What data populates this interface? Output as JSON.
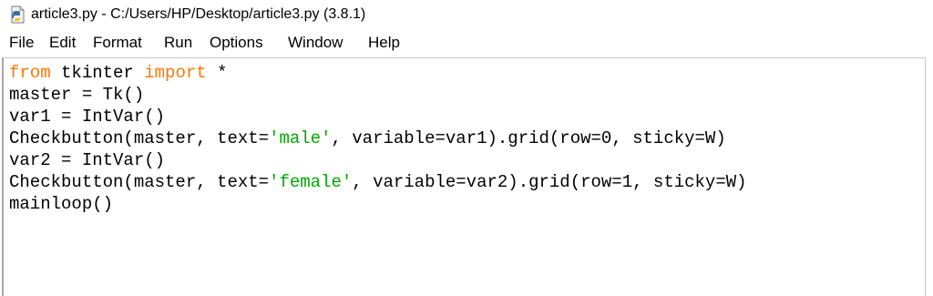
{
  "window": {
    "title": "article3.py - C:/Users/HP/Desktop/article3.py (3.8.1)",
    "icon": "python-file-icon"
  },
  "menu": [
    "File",
    "Edit",
    "Format",
    "Run",
    "Options",
    "Window",
    "Help"
  ],
  "code": [
    [
      {
        "t": "from",
        "c": "kw"
      },
      {
        "t": " tkinter "
      },
      {
        "t": "import",
        "c": "kw"
      },
      {
        "t": " *"
      }
    ],
    [
      {
        "t": "master = Tk()"
      }
    ],
    [
      {
        "t": "var1 = IntVar()"
      }
    ],
    [
      {
        "t": "Checkbutton(master, text="
      },
      {
        "t": "'male'",
        "c": "str"
      },
      {
        "t": ", variable=var1).grid(row=0, sticky=W)"
      }
    ],
    [
      {
        "t": "var2 = IntVar()"
      }
    ],
    [
      {
        "t": "Checkbutton(master, text="
      },
      {
        "t": "'female'",
        "c": "str"
      },
      {
        "t": ", variable=var2).grid(row=1, sticky=W)"
      }
    ],
    [
      {
        "t": "mainloop()"
      }
    ]
  ],
  "colors": {
    "keyword": "#ff7700",
    "string": "#00aa00",
    "text": "#000000",
    "background": "#ffffff"
  }
}
